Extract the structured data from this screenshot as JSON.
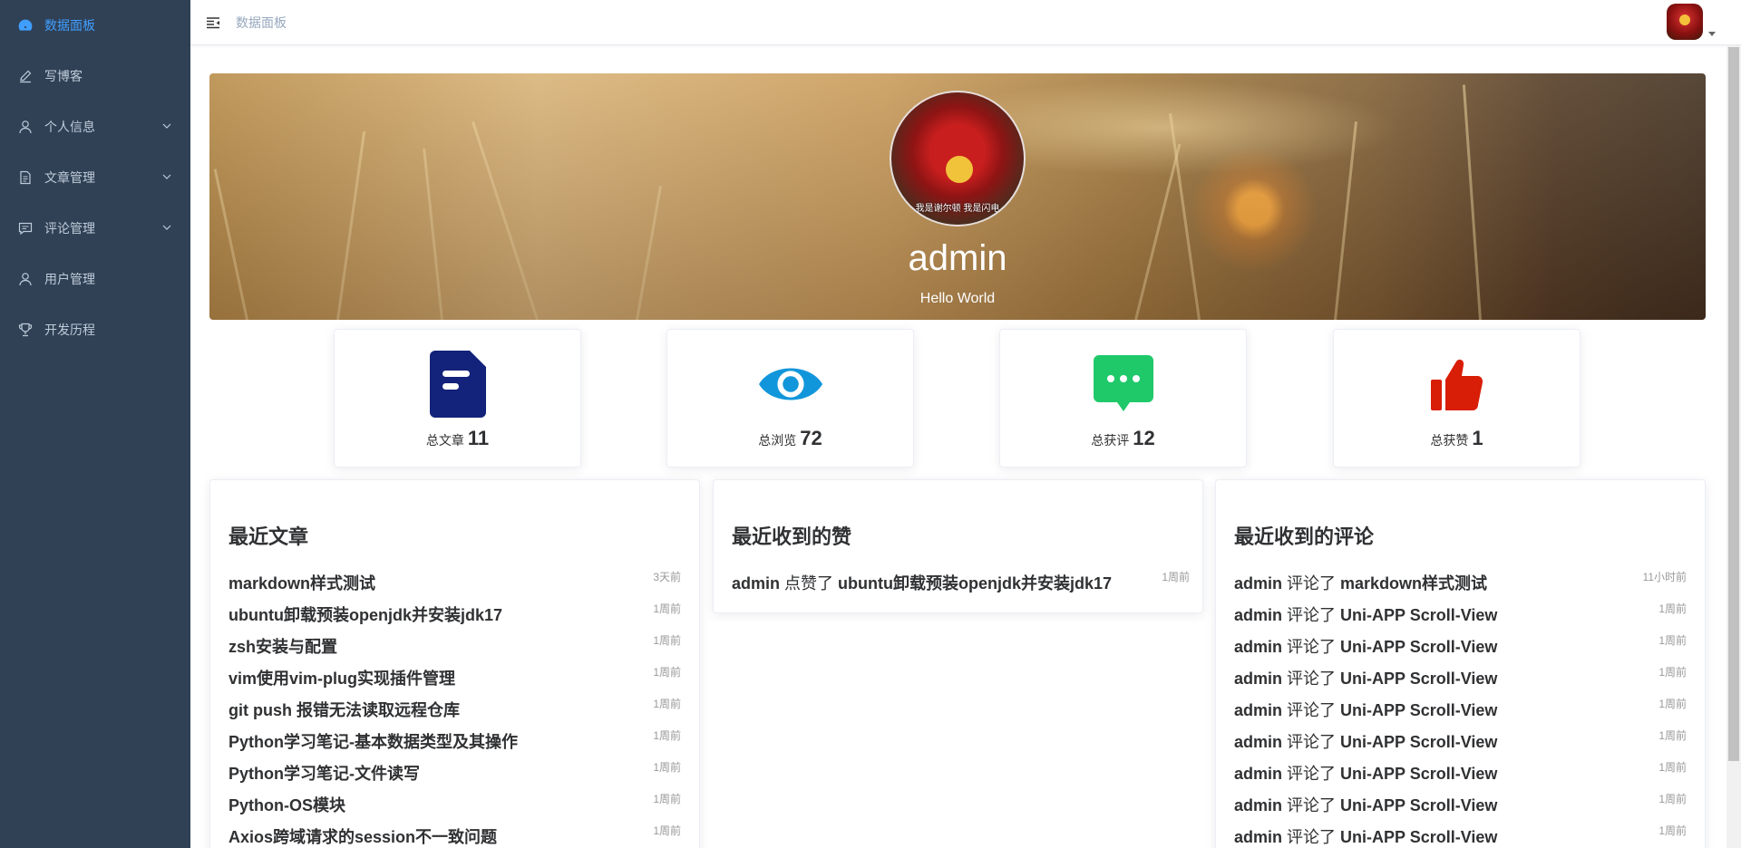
{
  "sidebar": {
    "items": [
      {
        "label": "数据面板",
        "icon": "dashboard-icon"
      },
      {
        "label": "写博客",
        "icon": "edit-icon"
      },
      {
        "label": "个人信息",
        "icon": "user-icon"
      },
      {
        "label": "文章管理",
        "icon": "document-icon"
      },
      {
        "label": "评论管理",
        "icon": "comment-icon"
      },
      {
        "label": "用户管理",
        "icon": "user-icon"
      },
      {
        "label": "开发历程",
        "icon": "trophy-icon"
      }
    ]
  },
  "navbar": {
    "breadcrumb": "数据面板"
  },
  "profile": {
    "avatar_caption": "我是谢尔顿  我是闪电",
    "name": "admin",
    "motto": "Hello World"
  },
  "stats": [
    {
      "label": "总文章",
      "value": "11",
      "icon": "article-icon",
      "color": "#13227a"
    },
    {
      "label": "总浏览",
      "value": "72",
      "icon": "eye-icon",
      "color": "#1296db"
    },
    {
      "label": "总获评",
      "value": "12",
      "icon": "chat-icon",
      "color": "#1fc96a"
    },
    {
      "label": "总获赞",
      "value": "1",
      "icon": "thumbs-up-icon",
      "color": "#d81e06"
    }
  ],
  "recent_articles": {
    "title": "最近文章",
    "rows": [
      {
        "text": "markdown样式测试",
        "time": "3天前"
      },
      {
        "text": "ubuntu卸载预装openjdk并安装jdk17",
        "time": "1周前"
      },
      {
        "text": "zsh安装与配置",
        "time": "1周前"
      },
      {
        "text": "vim使用vim-plug实现插件管理",
        "time": "1周前"
      },
      {
        "text": "git push 报错无法读取远程仓库",
        "time": "1周前"
      },
      {
        "text": "Python学习笔记-基本数据类型及其操作",
        "time": "1周前"
      },
      {
        "text": "Python学习笔记-文件读写",
        "time": "1周前"
      },
      {
        "text": "Python-OS模块",
        "time": "1周前"
      },
      {
        "text": "Axios跨域请求的session不一致问题",
        "time": "1周前"
      }
    ]
  },
  "recent_likes": {
    "title": "最近收到的赞",
    "rows": [
      {
        "user": "admin",
        "action": " 点赞了 ",
        "target": "ubuntu卸载预装openjdk并安装jdk17",
        "time": "1周前"
      }
    ]
  },
  "recent_comments": {
    "title": "最近收到的评论",
    "rows": [
      {
        "user": "admin",
        "action": " 评论了 ",
        "target": "markdown样式测试",
        "time": "11小时前"
      },
      {
        "user": "admin",
        "action": " 评论了 ",
        "target": "Uni-APP Scroll-View",
        "time": "1周前"
      },
      {
        "user": "admin",
        "action": " 评论了 ",
        "target": "Uni-APP Scroll-View",
        "time": "1周前"
      },
      {
        "user": "admin",
        "action": " 评论了 ",
        "target": "Uni-APP Scroll-View",
        "time": "1周前"
      },
      {
        "user": "admin",
        "action": " 评论了 ",
        "target": "Uni-APP Scroll-View",
        "time": "1周前"
      },
      {
        "user": "admin",
        "action": " 评论了 ",
        "target": "Uni-APP Scroll-View",
        "time": "1周前"
      },
      {
        "user": "admin",
        "action": " 评论了 ",
        "target": "Uni-APP Scroll-View",
        "time": "1周前"
      },
      {
        "user": "admin",
        "action": " 评论了 ",
        "target": "Uni-APP Scroll-View",
        "time": "1周前"
      },
      {
        "user": "admin",
        "action": " 评论了 ",
        "target": "Uni-APP Scroll-View",
        "time": "1周前"
      }
    ]
  },
  "colors": {
    "sidebar_bg": "#304156",
    "sidebar_text": "#bfcbd9",
    "sidebar_active": "#409eff"
  }
}
